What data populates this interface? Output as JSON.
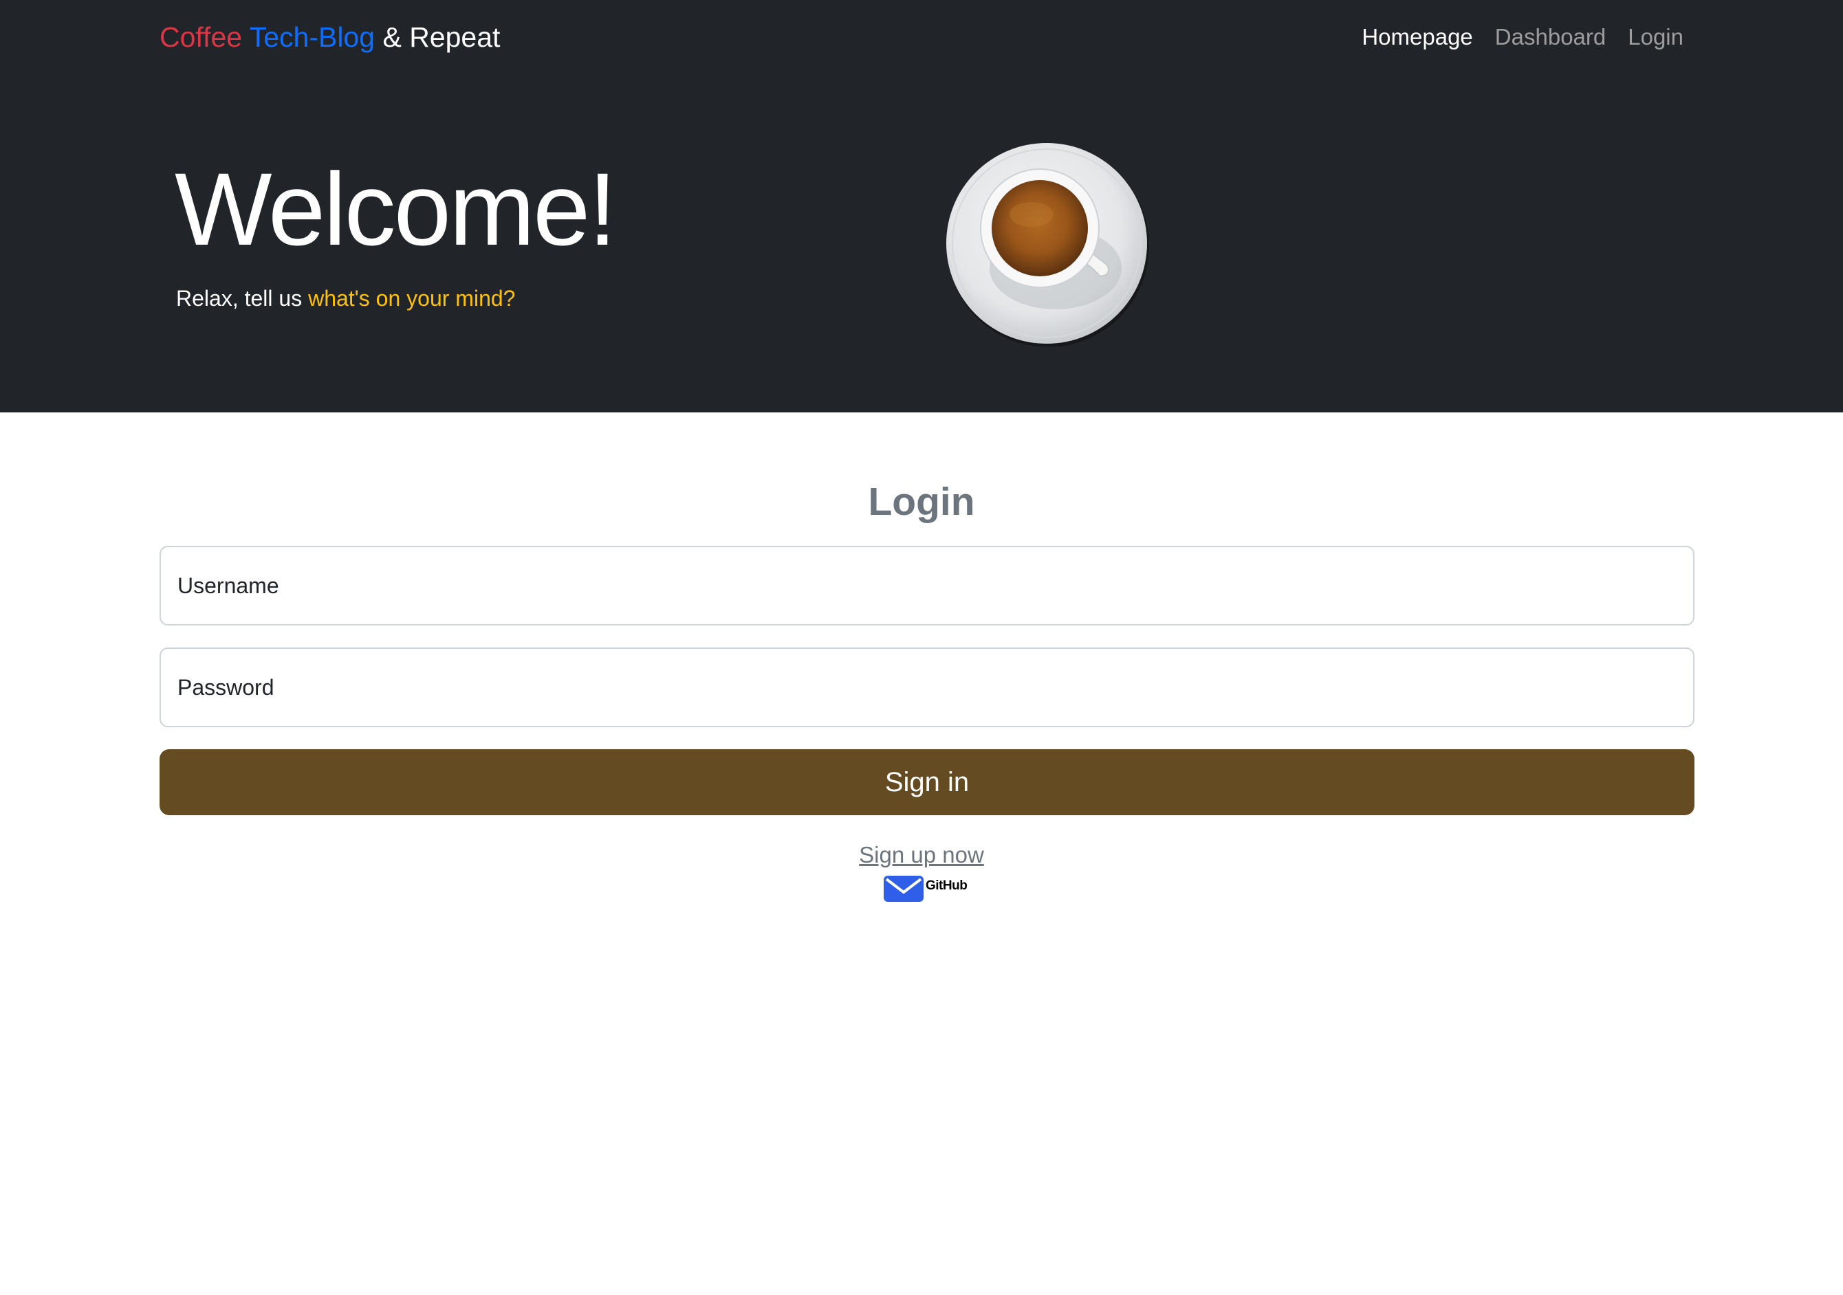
{
  "navbar": {
    "brand": {
      "part1": "Coffee",
      "part2": "Tech-Blog",
      "part3": "& Repeat"
    },
    "links": [
      {
        "label": "Homepage",
        "active": true
      },
      {
        "label": "Dashboard",
        "active": false
      },
      {
        "label": "Login",
        "active": false
      }
    ]
  },
  "hero": {
    "title": "Welcome!",
    "tagline_prefix": "Relax, tell us",
    "tagline_highlight": "what's on your mind?"
  },
  "login": {
    "title": "Login",
    "username_placeholder": "Username",
    "password_placeholder": "Password",
    "submit_label": "Sign in",
    "signup_link": "Sign up now"
  },
  "footer_links": {
    "github_label": "GitHub",
    "email_icon": "email-icon"
  },
  "colors": {
    "hero_bg": "#212429",
    "brand_red": "#dc3545",
    "brand_blue": "#0d6efd",
    "highlight_yellow": "#ffc107",
    "button_brown": "#654b21",
    "muted_gray": "#6c757d"
  }
}
